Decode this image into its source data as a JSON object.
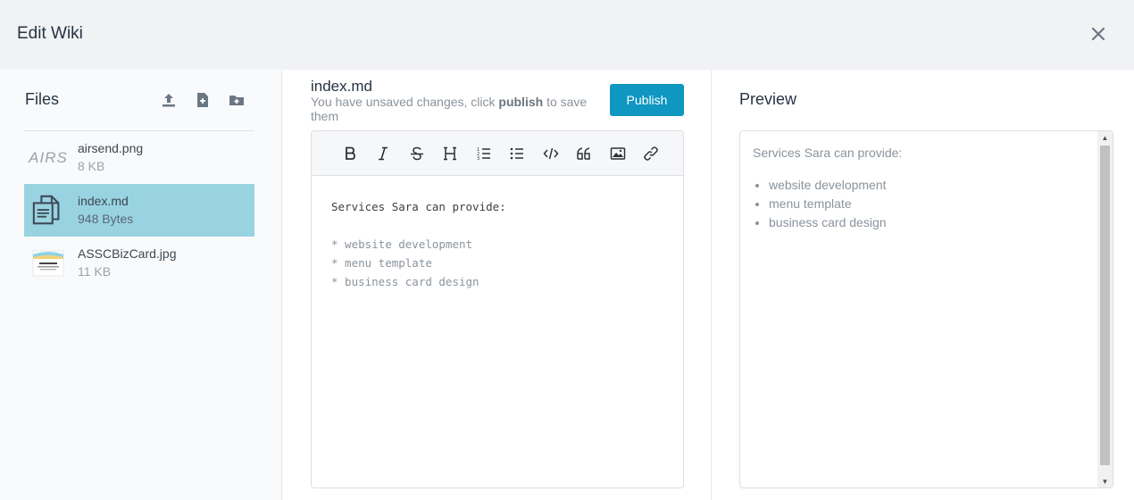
{
  "modal": {
    "title": "Edit Wiki"
  },
  "files": {
    "title": "Files",
    "actions": [
      "upload-icon",
      "new-file-icon",
      "new-folder-icon"
    ],
    "items": [
      {
        "name": "airsend.png",
        "size": "8 KB",
        "thumb_text": "AIRS",
        "selected": false
      },
      {
        "name": "index.md",
        "size": "948 Bytes",
        "selected": true
      },
      {
        "name": "ASSCBizCard.jpg",
        "size": "11 KB",
        "selected": false
      }
    ]
  },
  "editor": {
    "filename": "index.md",
    "unsaved_pre": "You have unsaved changes, click ",
    "unsaved_bold": "publish",
    "unsaved_post": " to save them",
    "publish_label": "Publish",
    "toolbar": [
      "bold-icon",
      "italic-icon",
      "strikethrough-icon",
      "heading-icon",
      "ordered-list-icon",
      "unordered-list-icon",
      "code-icon",
      "quote-icon",
      "image-icon",
      "link-icon"
    ],
    "lines": {
      "l1": "Services Sara can provide:",
      "l2": "* website development",
      "l3": "* menu template",
      "l4": "* business card design"
    }
  },
  "preview": {
    "title": "Preview",
    "intro": "Services Sara can provide:",
    "items": [
      "website development",
      "menu template",
      "business card design"
    ]
  },
  "colors": {
    "accent": "#0f96c1",
    "selected_row": "#99d3e2",
    "header_bg": "#f1f2f4"
  }
}
